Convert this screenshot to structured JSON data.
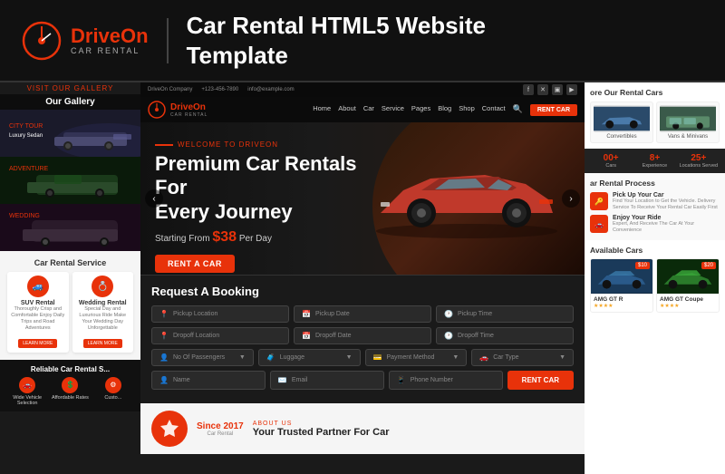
{
  "header": {
    "logo_drive": "Drive",
    "logo_on": "On",
    "logo_subtitle": "CAR RENTAL",
    "title_line1": "Car Rental HTML5 Website",
    "title_line2": "Template"
  },
  "top_bar": {
    "company": "DriveOn Company",
    "phone": "+123-456-7890",
    "email": "info@example.com"
  },
  "nav": {
    "brand": "Drive",
    "brand_accent": "On",
    "brand_sub": "Car Rental",
    "links": [
      "Home",
      "About",
      "Car",
      "Service",
      "Pages",
      "Blog",
      "Shop",
      "Contact"
    ],
    "cta": "RENT CAR"
  },
  "hero": {
    "sub_label": "Welcome To DriveOn",
    "title_line1": "Premium Car Rentals For",
    "title_line2": "Every Journey",
    "price_prefix": "Starting From",
    "price": "$38",
    "price_suffix": "Per Day",
    "cta": "RENT A CAR"
  },
  "booking": {
    "title": "Request A Booking",
    "fields": [
      {
        "placeholder": "Pickup Location",
        "icon": "📍"
      },
      {
        "placeholder": "Pickup Date",
        "icon": "📅"
      },
      {
        "placeholder": "Pickup Time",
        "icon": "🕐"
      },
      {
        "placeholder": "Dropoff Location",
        "icon": "📍"
      },
      {
        "placeholder": "Dropoff Date",
        "icon": "📅"
      },
      {
        "placeholder": "Dropoff Time",
        "icon": "🕐"
      },
      {
        "placeholder": "No Of Passengers",
        "icon": "👤"
      },
      {
        "placeholder": "Luggage",
        "icon": "🧳"
      },
      {
        "placeholder": "Payment Method",
        "icon": "💳"
      },
      {
        "placeholder": "Car Type",
        "icon": "🚗"
      },
      {
        "placeholder": "Name",
        "icon": "👤"
      },
      {
        "placeholder": "Email",
        "icon": "✉️"
      },
      {
        "placeholder": "Phone Number",
        "icon": "📱"
      }
    ],
    "submit": "RENT CAR"
  },
  "about": {
    "label": "About Us",
    "title": "Your Trusted Partner For Car",
    "since": "Since 2017",
    "sub": "Car Rental"
  },
  "gallery": {
    "label": "Visit Our Gallery",
    "title": "Our Gallery"
  },
  "services": {
    "title": "Car Rental Service",
    "items": [
      {
        "title": "SUV Rental",
        "desc": "Thoroughly Crisp and Comfortable Enjoy Daily Trips and Road Adventures",
        "btn": "LEARN MORE"
      },
      {
        "title": "Wedding Rental",
        "desc": "Special Day and Luxurious Ride Make Your Wedding Day Unforgettable",
        "btn": "LEARN MORE"
      }
    ]
  },
  "reliable": {
    "title": "Reliable Car Rental S...",
    "features": [
      {
        "label": "Wide Vehicle Selection"
      },
      {
        "label": "Affordable Rates"
      },
      {
        "label": "Custo..."
      }
    ]
  },
  "right_panel": {
    "cars_title": "ore Our Rental Cars",
    "car_types": [
      {
        "label": "Convertibles"
      },
      {
        "label": "Vans & Minivans"
      }
    ],
    "stats": [
      {
        "num": "00+",
        "label": "Cars"
      },
      {
        "num": "8+",
        "label": "Experience"
      },
      {
        "num": "25+",
        "label": "Locations Served"
      }
    ],
    "process_title": "ar Rental Process",
    "steps": [
      {
        "title": "Pick Up Your Car",
        "desc": "Find Your Location to Get the Vehicle. Delivery Service To Receive Your Rental Car Easily First"
      },
      {
        "title": "Enjoy Your Ride",
        "desc": "Expert, And Receive The Car At Your Convenience"
      }
    ],
    "available_title": "Available Cars",
    "cars": [
      {
        "name": "AMG GT R",
        "stars": "★★★★",
        "price": "$10",
        "badge": "$10"
      },
      {
        "name": "AMG GT Coupe",
        "stars": "★★★★",
        "price": "$20",
        "badge": "$20"
      }
    ]
  }
}
